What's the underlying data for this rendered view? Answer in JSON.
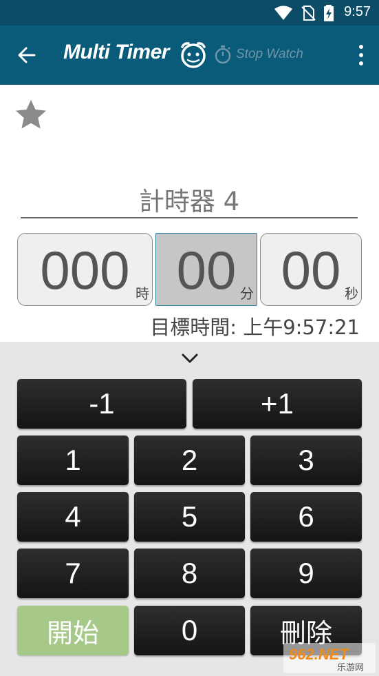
{
  "status_bar": {
    "time": "9:57"
  },
  "app_bar": {
    "title": "Multi Timer",
    "stopwatch_label": "Stop Watch"
  },
  "timer": {
    "name": "計時器 4",
    "hours": "000",
    "hours_unit": "時",
    "minutes": "00",
    "minutes_unit": "分",
    "seconds": "00",
    "seconds_unit": "秒",
    "target_time": "目標時間: 上午9:57:21"
  },
  "keypad": {
    "minus_one": "-1",
    "plus_one": "+1",
    "key_1": "1",
    "key_2": "2",
    "key_3": "3",
    "key_4": "4",
    "key_5": "5",
    "key_6": "6",
    "key_7": "7",
    "key_8": "8",
    "key_9": "9",
    "key_0": "0",
    "start_label": "開始",
    "delete_label": "刪除"
  },
  "watermark": {
    "text_main": "962.NET",
    "text_sub": "乐游网"
  },
  "colors": {
    "status_bar": "#0d4c66",
    "app_bar": "#0a5a7a",
    "start_button": "#a6c98a",
    "selected_border": "#2a7fa3"
  }
}
